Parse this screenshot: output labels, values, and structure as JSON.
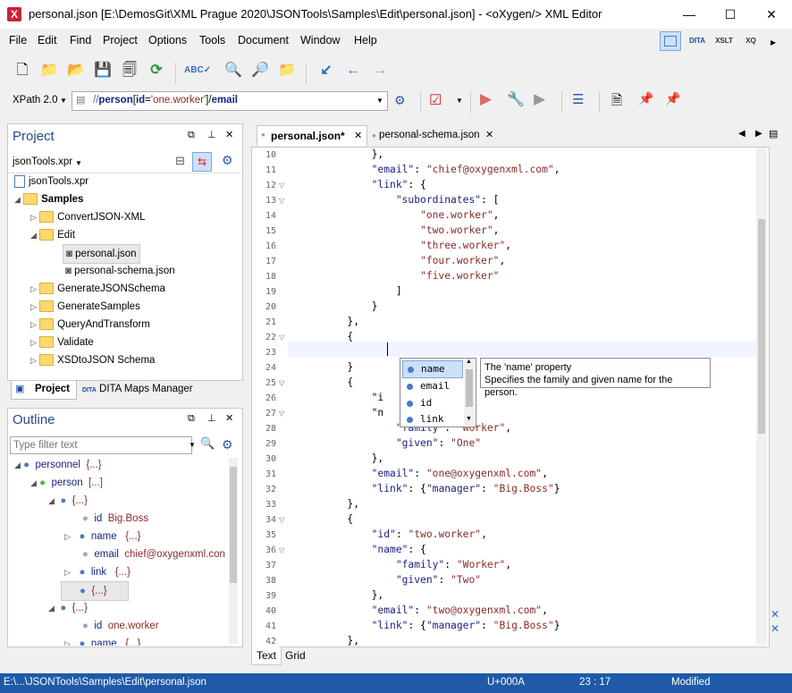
{
  "window": {
    "title": "personal.json [E:\\DemosGit\\XML Prague 2020\\JSONTools\\Samples\\Edit\\personal.json] - <oXygen/> XML Editor",
    "minimize": "—",
    "maximize": "☐",
    "close": "✕"
  },
  "menu": [
    "File",
    "Edit",
    "Find",
    "Project",
    "Options",
    "Tools",
    "Document",
    "Window",
    "Help"
  ],
  "perspectives": [
    "",
    "DITA",
    "XSLT",
    "XQ"
  ],
  "xpath": {
    "version": "XPath 2.0",
    "parts": {
      "p1": "//",
      "p2": "person",
      "p3": "[",
      "p4": "id",
      "p5": "=",
      "p6": "'one.worker'",
      "p7": "]/",
      "p8": "email"
    }
  },
  "project": {
    "title": "Project",
    "file": "jsonTools.xpr",
    "root": "jsonTools.xpr",
    "items": [
      "Samples",
      "ConvertJSON-XML",
      "Edit",
      "personal.json",
      "personal-schema.json",
      "GenerateJSONSchema",
      "GenerateSamples",
      "QueryAndTransform",
      "Validate",
      "XSDtoJSON Schema"
    ],
    "tabs": [
      "Project",
      "DITA Maps Manager"
    ]
  },
  "outline": {
    "title": "Outline",
    "filter_placeholder": "Type filter text",
    "rows": [
      {
        "name": "personnel",
        "value": "{...}"
      },
      {
        "name": "person",
        "value": "[...]"
      },
      {
        "name": "",
        "value": "{...}"
      },
      {
        "name": "id",
        "value": "Big.Boss"
      },
      {
        "name": "name",
        "value": "{...}"
      },
      {
        "name": "email",
        "value": "chief@oxygenxml.con"
      },
      {
        "name": "link",
        "value": "{...}"
      },
      {
        "name": "",
        "value": "{...}"
      },
      {
        "name": "",
        "value": "{...}"
      },
      {
        "name": "id",
        "value": "one.worker"
      },
      {
        "name": "name",
        "value": "{...}"
      }
    ]
  },
  "editor": {
    "tabs": [
      "personal.json*",
      "personal-schema.json"
    ],
    "bottom_tabs": [
      "Text",
      "Grid"
    ],
    "lines": [
      {
        "n": "10",
        "t": "            },"
      },
      {
        "n": "11",
        "t": "            \"email\": \"chief@oxygenxml.com\","
      },
      {
        "n": "12",
        "t": "            \"link\": {"
      },
      {
        "n": "13",
        "t": "                \"subordinates\": ["
      },
      {
        "n": "14",
        "t": "                    \"one.worker\","
      },
      {
        "n": "15",
        "t": "                    \"two.worker\","
      },
      {
        "n": "16",
        "t": "                    \"three.worker\","
      },
      {
        "n": "17",
        "t": "                    \"four.worker\","
      },
      {
        "n": "18",
        "t": "                    \"five.worker\""
      },
      {
        "n": "19",
        "t": "                ]"
      },
      {
        "n": "20",
        "t": "            }"
      },
      {
        "n": "21",
        "t": "        },"
      },
      {
        "n": "22",
        "t": "        {"
      },
      {
        "n": "23",
        "t": "            "
      },
      {
        "n": "24",
        "t": "        }"
      },
      {
        "n": "25",
        "t": "        {"
      },
      {
        "n": "26",
        "t": "            \"i"
      },
      {
        "n": "27",
        "t": "            \"n"
      },
      {
        "n": "28",
        "t": "                \"family\": \"Worker\","
      },
      {
        "n": "29",
        "t": "                \"given\": \"One\""
      },
      {
        "n": "30",
        "t": "            },"
      },
      {
        "n": "31",
        "t": "            \"email\": \"one@oxygenxml.com\","
      },
      {
        "n": "32",
        "t": "            \"link\": {\"manager\": \"Big.Boss\"}"
      },
      {
        "n": "33",
        "t": "        },"
      },
      {
        "n": "34",
        "t": "        {"
      },
      {
        "n": "35",
        "t": "            \"id\": \"two.worker\","
      },
      {
        "n": "36",
        "t": "            \"name\": {"
      },
      {
        "n": "37",
        "t": "                \"family\": \"Worker\","
      },
      {
        "n": "38",
        "t": "                \"given\": \"Two\""
      },
      {
        "n": "39",
        "t": "            },"
      },
      {
        "n": "40",
        "t": "            \"email\": \"two@oxygenxml.com\","
      },
      {
        "n": "41",
        "t": "            \"link\": {\"manager\": \"Big.Boss\"}"
      },
      {
        "n": "42",
        "t": "        },"
      }
    ]
  },
  "completion": {
    "items": [
      "name",
      "email",
      "id",
      "link"
    ],
    "doc_title": "The 'name' property",
    "doc_text": "Specifies the family and given name for the person."
  },
  "status": {
    "path": "E:\\...\\JSONTools\\Samples\\Edit\\personal.json",
    "unicode": "U+000A",
    "position": "23 : 17",
    "state": "Modified"
  }
}
